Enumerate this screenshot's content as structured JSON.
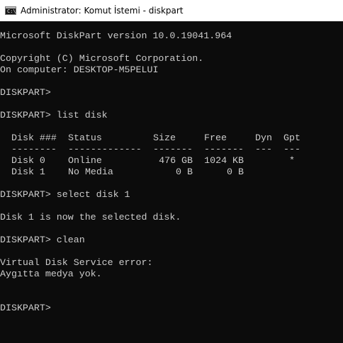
{
  "window": {
    "title": "Administrator: Komut İstemi - diskpart",
    "icon": "command-prompt-icon",
    "icon_glyph": "C:\\"
  },
  "console": {
    "version_line": "Microsoft DiskPart version 10.0.19041.964",
    "copyright_line": "Copyright (C) Microsoft Corporation.",
    "computer_line": "On computer: DESKTOP-M5PELUI",
    "prompt1": "DISKPART>",
    "prompt2": "DISKPART> list disk",
    "table": {
      "headers": {
        "disk": "Disk ###",
        "status": "Status",
        "size": "Size",
        "free": "Free",
        "dyn": "Dyn",
        "gpt": "Gpt"
      },
      "separators": {
        "disk": "--------",
        "status": "-------------",
        "size": "-------",
        "free": "-------",
        "dyn": "---",
        "gpt": "---"
      },
      "rows": [
        {
          "disk": "Disk 0",
          "status": "Online",
          "size": "476 GB",
          "free": "1024 KB",
          "dyn": "",
          "gpt": "*"
        },
        {
          "disk": "Disk 1",
          "status": "No Media",
          "size": "0 B",
          "free": "0 B",
          "dyn": "",
          "gpt": ""
        }
      ]
    },
    "prompt3": "DISKPART> select disk 1",
    "select_result": "Disk 1 is now the selected disk.",
    "prompt4": "DISKPART> clean",
    "error_line1": "Virtual Disk Service error:",
    "error_line2": "Aygıtta medya yok.",
    "prompt5": "DISKPART>"
  },
  "colors": {
    "console_background": "#0c0c0c",
    "console_text": "#cccccc",
    "titlebar_background": "#ffffff",
    "titlebar_text": "#000000"
  }
}
